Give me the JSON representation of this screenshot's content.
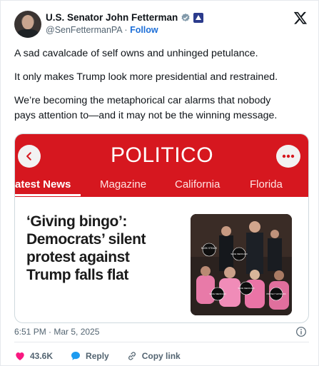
{
  "author": {
    "display_name": "U.S. Senator John Fetterman",
    "handle": "@SenFettermanPA",
    "separator": " · ",
    "follow_label": "Follow"
  },
  "tweet": {
    "paragraphs": [
      "A sad cavalcade of self owns and unhinged petulance.",
      "It only makes Trump look more presidential and restrained.",
      "We’re becoming the metaphorical car alarms that nobody",
      "pays attention to—and it may not be the winning message."
    ]
  },
  "embed": {
    "brand": "POLITICO",
    "nav": [
      "atest News",
      "Magazine",
      "California",
      "Florida"
    ],
    "headline": "‘Giving bingo’: Democrats’ silent protest against Trump falls flat",
    "photo_signs": [
      "MUSK STEALS",
      "SAVE MEDICAID",
      "SAVE MEDICAID",
      "SAVE MEDICAID",
      "PROTECT VETERANS"
    ]
  },
  "meta": {
    "timestamp": "6:51 PM · Mar 5, 2025"
  },
  "actions": {
    "likes": "43.6K",
    "reply_label": "Reply",
    "copy_link_label": "Copy link"
  },
  "colors": {
    "politico_red": "#d6171f",
    "like_pink": "#f91880",
    "reply_blue": "#1d9bf0",
    "link_blue": "#1d6fd8",
    "verified_gray": "#829aab"
  },
  "icons": [
    "verified-badge-icon",
    "senate-badge-icon",
    "x-logo-icon",
    "chevron-left-icon",
    "more-dots-icon",
    "info-icon",
    "heart-icon",
    "reply-bubble-icon",
    "link-icon"
  ]
}
